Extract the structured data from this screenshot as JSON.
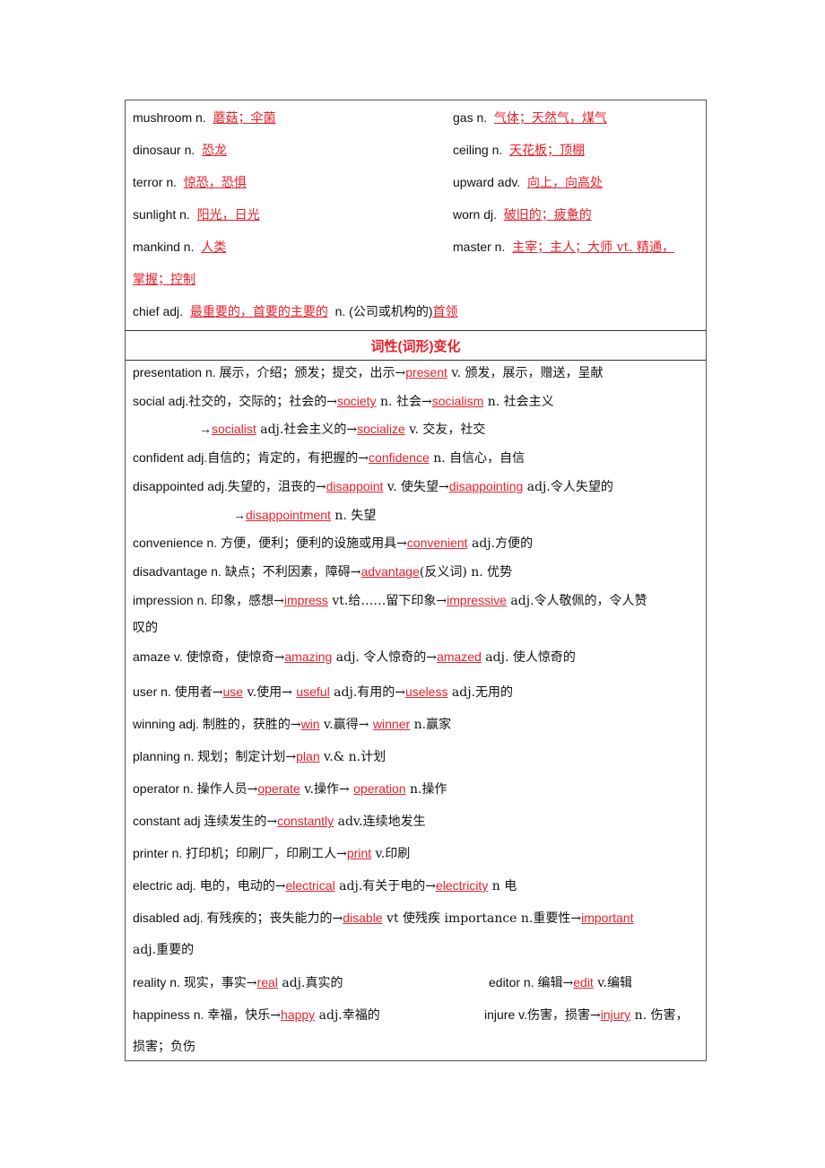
{
  "vocab": [
    {
      "word": "mushroom n.",
      "meaning": "蘑菇；伞菌"
    },
    {
      "word": "gas n.",
      "meaning": "气体；天然气，煤气"
    },
    {
      "word": "dinosaur n.",
      "meaning": "恐龙"
    },
    {
      "word": "ceiling n.",
      "meaning": "天花板；顶棚"
    },
    {
      "word": "terror n.",
      "meaning": "惊恐，恐惧"
    },
    {
      "word": "upward adv.",
      "meaning": "向上，向高处"
    },
    {
      "word": "sunlight n.",
      "meaning": "阳光，日光"
    },
    {
      "word": "worn dj.",
      "meaning": "破旧的；疲惫的"
    },
    {
      "word": "mankind n.",
      "meaning": "人类"
    },
    {
      "word": "master n.",
      "meaning": "主宰；主人；大师 vt. 精通，",
      "meaning_cont": "掌握；控制"
    },
    {
      "word": "chief adj.",
      "meaning": "最重要的，首要的主要的",
      "extra": "n. (公司或机构的)",
      "extra_red": "首领"
    }
  ],
  "section_header": "词性(词形)变化",
  "forms": {
    "presentation": {
      "a": "presentation n. ",
      "b": "展示，介绍；颁发；提交，出示→",
      "r1": "present",
      "c": " v. 颁发，展示，赠送，呈献"
    },
    "social": {
      "a": "social adj.",
      "b": "社交的，交际的；社会的→",
      "r1": "society",
      "c": " n. 社会→",
      "r2": "socialism",
      "d": " n. 社会主义"
    },
    "social2": {
      "a": "→",
      "r1": "socialist",
      "b": " adj.社会主义的→",
      "r2": "socialize",
      "c": " v. 交友，社交"
    },
    "confident": {
      "a": "confident adj.",
      "b": "自信的；肯定的，有把握的→",
      "r1": "confidence",
      "c": " n. 自信心，自信"
    },
    "disappointed": {
      "a": "disappointed adj.",
      "b": "失望的，沮丧的→",
      "r1": "disappoint",
      "c": " v. 使失望→",
      "r2": "disappointing",
      "d": " adj.令人失望的"
    },
    "disappointed2": {
      "a": "→",
      "r1": "disappointment",
      "b": " n. 失望"
    },
    "convenience": {
      "a": "convenience n. ",
      "b": "方便，便利；便利的设施或用具→",
      "r1": "convenient",
      "c": " adj.方便的"
    },
    "disadvantage": {
      "a": "disadvantage n. ",
      "b": "缺点；不利因素，障碍→",
      "r1": "advantage",
      "c": "(反义词) n. 优势"
    },
    "impression": {
      "a": "impression n. ",
      "b": "印象，感想→",
      "r1": "impress",
      "c": " vt.给……留下印象→",
      "r2": "impressive",
      "d": " adj.令人敬佩的，令人赞"
    },
    "impression2": {
      "a": "叹的"
    },
    "amaze": {
      "a": "amaze v. ",
      "b": "使惊奇，使惊奇→",
      "r1": "amazing",
      "c": " adj. 令人惊奇的→",
      "r2": "amazed",
      "d": " adj. 使人惊奇的"
    },
    "user": {
      "a": "user n. ",
      "b": "使用者→",
      "r1": "use",
      "c": " v.使用→ ",
      "r2": "useful",
      "d": " adj.有用的→",
      "r3": "useless",
      "e": " adj.无用的"
    },
    "winning": {
      "a": "winning adj. ",
      "b": "制胜的，获胜的→",
      "r1": "win",
      "c": " v.赢得→ ",
      "r2": "winner",
      "d": " n.赢家"
    },
    "planning": {
      "a": "planning n. ",
      "b": "规划；制定计划→",
      "r1": "plan",
      "c": " v.& n.计划"
    },
    "operator": {
      "a": "operator n. ",
      "b": "操作人员→",
      "r1": "operate",
      "c": " v.操作→ ",
      "r2": "operation",
      "d": " n.操作"
    },
    "constant": {
      "a": "constant adj ",
      "b": "连续发生的→",
      "r1": "constantly",
      "c": " adv.连续地发生"
    },
    "printer": {
      "a": "printer n. ",
      "b": "打印机；印刷厂，印刷工人→",
      "r1": "print",
      "c": " v.印刷"
    },
    "electric": {
      "a": "electric adj. ",
      "b": "电的，电动的→",
      "r1": "electrical",
      "c": " adj.有关于电的→",
      "r2": "electricity",
      "d": " n 电"
    },
    "disabled": {
      "a": "disabled adj. ",
      "b": "有残疾的；丧失能力的→",
      "r1": "disable",
      "c": " vt 使残疾    importance n.重要性→",
      "r2": "important"
    },
    "disabled2": {
      "a": "adj.重要的"
    },
    "reality": {
      "a": "reality n. ",
      "b": "现实，事实→",
      "r1": "real",
      "c": " adj.真实的"
    },
    "editor": {
      "a": "editor n. ",
      "b": "编辑→",
      "r1": "edit",
      "c": " v.编辑"
    },
    "happiness": {
      "a": "happiness n. ",
      "b": "幸福，快乐→",
      "r1": "happy",
      "c": " adj.幸福的"
    },
    "injure": {
      "a": "injure v.",
      "b": "伤害，损害→",
      "r1": "injury",
      "c": " n. 伤害，"
    },
    "injure2": {
      "a": "损害；负伤"
    }
  }
}
